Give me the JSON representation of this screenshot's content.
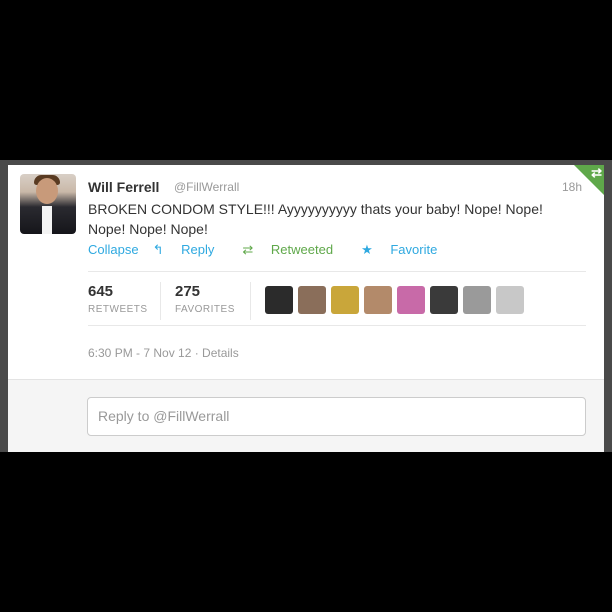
{
  "tweet": {
    "author_name": "Will Ferrell",
    "author_handle": "@FillWerrall",
    "age": "18h",
    "text": "BROKEN CONDOM STYLE!!! Ayyyyyyyyyy thats your baby! Nope! Nope! Nope! Nope! Nope!"
  },
  "actions": {
    "collapse": "Collapse",
    "reply": "Reply",
    "retweeted": "Retweeted",
    "favorite": "Favorite"
  },
  "stats": {
    "retweets_count": "645",
    "retweets_label": "RETWEETS",
    "favorites_count": "275",
    "favorites_label": "FAVORITES"
  },
  "favoriters": [
    {
      "color": "#2b2b2b"
    },
    {
      "color": "#8a6e5a"
    },
    {
      "color": "#c9a63a"
    },
    {
      "color": "#b38a6a"
    },
    {
      "color": "#c86aa8"
    },
    {
      "color": "#3a3a3a"
    },
    {
      "color": "#9a9a9a"
    },
    {
      "color": "#c8c8c8"
    }
  ],
  "meta": "6:30 PM - 7 Nov 12 · Details",
  "reply_placeholder": "Reply to @FillWerrall",
  "colors": {
    "link": "#2fa9e0",
    "retweet": "#5fa84a"
  }
}
